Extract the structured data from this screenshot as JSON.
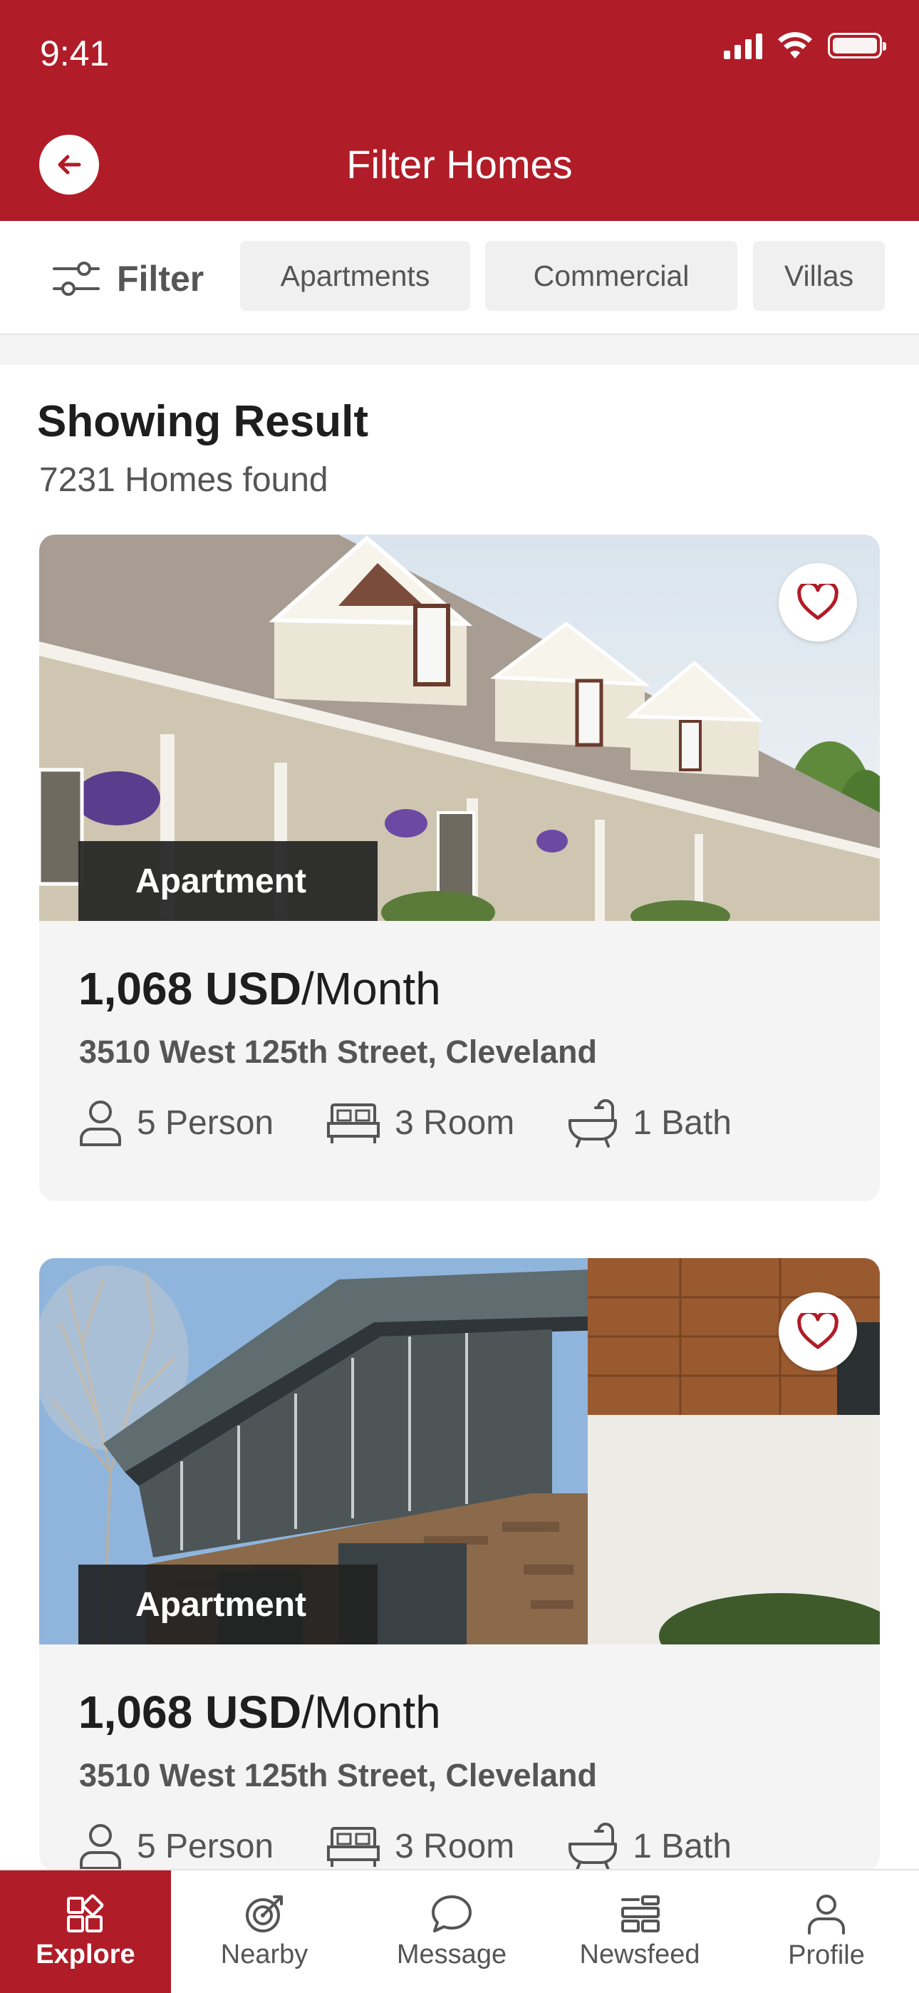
{
  "status_bar": {
    "time": "9:41"
  },
  "header": {
    "title": "Filter Homes"
  },
  "filters": {
    "filter_label": "Filter",
    "chips": [
      "Apartments",
      "Commercial",
      "Villas"
    ]
  },
  "results": {
    "title": "Showing Result",
    "count_text": "7231 Homes found"
  },
  "listings": [
    {
      "type": "Apartment",
      "price": "1,068 USD",
      "period": "/Month",
      "address": "3510 West 125th Street, Cleveland",
      "persons": "5 Person",
      "rooms": "3 Room",
      "baths": "1 Bath"
    },
    {
      "type": "Apartment",
      "price": "1,068 USD",
      "period": "/Month",
      "address": "3510 West 125th Street, Cleveland",
      "persons": "5 Person",
      "rooms": "3 Room",
      "baths": "1 Bath"
    }
  ],
  "bottom_nav": {
    "explore": "Explore",
    "nearby": "Nearby",
    "message": "Message",
    "newsfeed": "Newsfeed",
    "profile": "Profile"
  },
  "colors": {
    "brand": "#b01c27",
    "card_bg": "#f4f4f4",
    "text_muted": "#555555"
  },
  "icons": [
    "wifi-icon",
    "signal-icon",
    "battery-icon",
    "back-arrow-icon",
    "sliders-icon",
    "heart-icon",
    "person-icon",
    "bed-icon",
    "bathtub-icon",
    "grid-icon",
    "target-icon",
    "chat-icon",
    "newsfeed-icon",
    "profile-icon"
  ]
}
